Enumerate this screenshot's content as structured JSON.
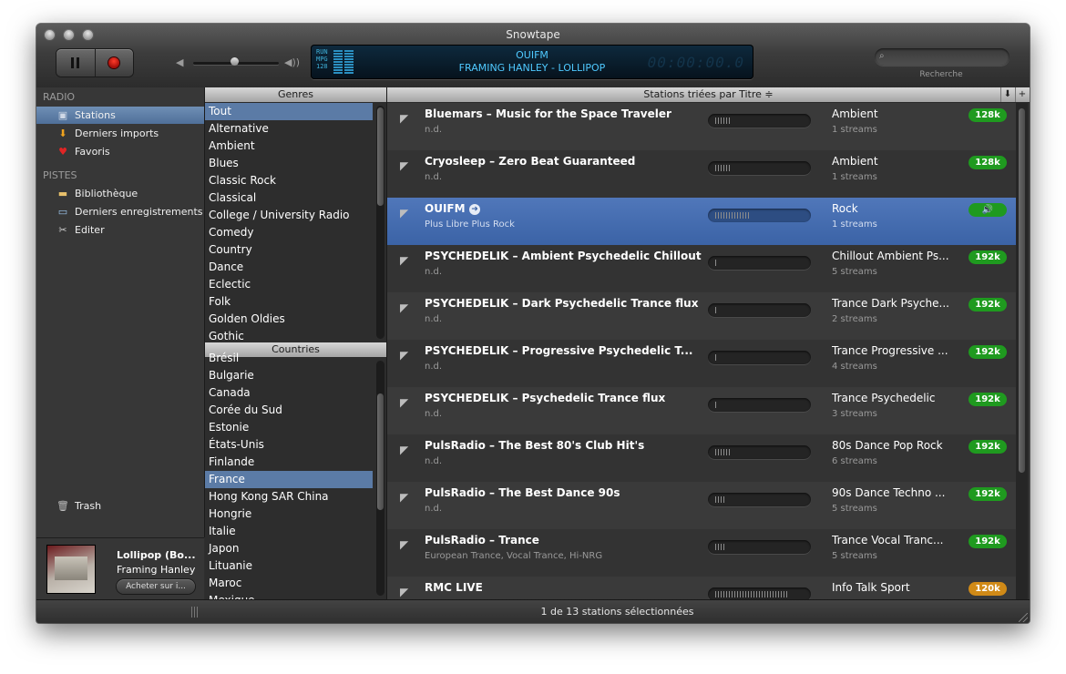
{
  "window": {
    "title": "Snowtape"
  },
  "player": {
    "lcd_station": "OUIFM",
    "lcd_track": "FRAMING HANLEY  - LOLLIPOP",
    "lcd_info_1": "RUN",
    "lcd_info_2": "MPG",
    "lcd_info_3": "128",
    "lcd_time": "00:00:00.0",
    "volume_level": 0.5
  },
  "search": {
    "placeholder": "",
    "label": "Recherche"
  },
  "sidebar": {
    "radio_header": "RADIO",
    "radio_items": [
      {
        "label": "Stations",
        "icon": "radio-icon"
      },
      {
        "label": "Derniers imports",
        "icon": "import-arrow-icon"
      },
      {
        "label": "Favoris",
        "icon": "heart-icon"
      }
    ],
    "pistes_header": "PISTES",
    "pistes_items": [
      {
        "label": "Bibliothèque",
        "icon": "folder-icon"
      },
      {
        "label": "Derniers enregistrements",
        "icon": "cassette-icon"
      },
      {
        "label": "Editer",
        "icon": "scissors-icon"
      }
    ],
    "trash": "Trash"
  },
  "now_playing": {
    "title": "Lollipop (Bo...",
    "artist": "Framing Hanley",
    "buy_button": "Acheter sur i..."
  },
  "genres": {
    "header": "Genres",
    "items": [
      "Tout",
      "Alternative",
      "Ambient",
      "Blues",
      "Classic Rock",
      "Classical",
      "College / University Radio",
      "Comedy",
      "Country",
      "Dance",
      "Eclectic",
      "Folk",
      "Golden Oldies",
      "Gothic"
    ],
    "selected": "Tout"
  },
  "countries": {
    "header": "Countries",
    "items": [
      "Brésil",
      "Bulgarie",
      "Canada",
      "Corée du Sud",
      "Estonie",
      "États-Unis",
      "Finlande",
      "France",
      "Hong Kong SAR China",
      "Hongrie",
      "Italie",
      "Japon",
      "Lituanie",
      "Maroc",
      "Mexique"
    ],
    "selected": "France"
  },
  "stations": {
    "header": "Stations triées par  Titre  ≑",
    "rows": [
      {
        "name": "Bluemars – Music for the Space Traveler",
        "desc": "n.d.",
        "genre": "Ambient",
        "streams": "1 streams",
        "badge": "128k",
        "badge_color": "#1f9a1f",
        "signal": 0.16
      },
      {
        "name": "Cryosleep – Zero Beat Guaranteed",
        "desc": "n.d.",
        "genre": "Ambient",
        "streams": "1 streams",
        "badge": "128k",
        "badge_color": "#1f9a1f",
        "signal": 0.16
      },
      {
        "name": "OUIFM",
        "desc": "Plus Libre Plus Rock",
        "genre": "Rock",
        "streams": "1 streams",
        "badge": "🔊",
        "badge_color": "#1f9a1f",
        "signal": 0.4,
        "selected": true
      },
      {
        "name": "PSYCHEDELIK – Ambient Psychedelic Chillout",
        "desc": "n.d.",
        "genre": "Chillout Ambient Ps...",
        "streams": "5 streams",
        "badge": "192k",
        "badge_color": "#1f9a1f",
        "signal": 0.02
      },
      {
        "name": "PSYCHEDELIK – Dark Psychedelic Trance flux",
        "desc": "n.d.",
        "genre": "Trance Dark Psyche...",
        "streams": "2 streams",
        "badge": "192k",
        "badge_color": "#1f9a1f",
        "signal": 0.02
      },
      {
        "name": "PSYCHEDELIK – Progressive Psychedelic T...",
        "desc": "n.d.",
        "genre": "Trance Progressive ...",
        "streams": "4 streams",
        "badge": "192k",
        "badge_color": "#1f9a1f",
        "signal": 0.02
      },
      {
        "name": "PSYCHEDELIK – Psychedelic Trance flux",
        "desc": "n.d.",
        "genre": "Trance Psychedelic",
        "streams": "3 streams",
        "badge": "192k",
        "badge_color": "#1f9a1f",
        "signal": 0.02
      },
      {
        "name": "PulsRadio – The Best 80's Club Hit's",
        "desc": "n.d.",
        "genre": "80s Dance Pop Rock",
        "streams": "6 streams",
        "badge": "192k",
        "badge_color": "#1f9a1f",
        "signal": 0.16
      },
      {
        "name": "PulsRadio – The Best Dance 90s",
        "desc": "n.d.",
        "genre": "90s Dance Techno ...",
        "streams": "5 streams",
        "badge": "192k",
        "badge_color": "#1f9a1f",
        "signal": 0.12
      },
      {
        "name": "PulsRadio – Trance",
        "desc": "European Trance, Vocal Trance, Hi-NRG",
        "genre": "Trance Vocal Tranc...",
        "streams": "5 streams",
        "badge": "192k",
        "badge_color": "#1f9a1f",
        "signal": 0.12
      },
      {
        "name": "RMC LIVE",
        "desc": "",
        "genre": "Info Talk Sport",
        "streams": "",
        "badge": "120k",
        "badge_color": "#d08a17",
        "signal": 0.82
      }
    ]
  },
  "status": {
    "text": "1 de 13 stations sélectionnées"
  }
}
